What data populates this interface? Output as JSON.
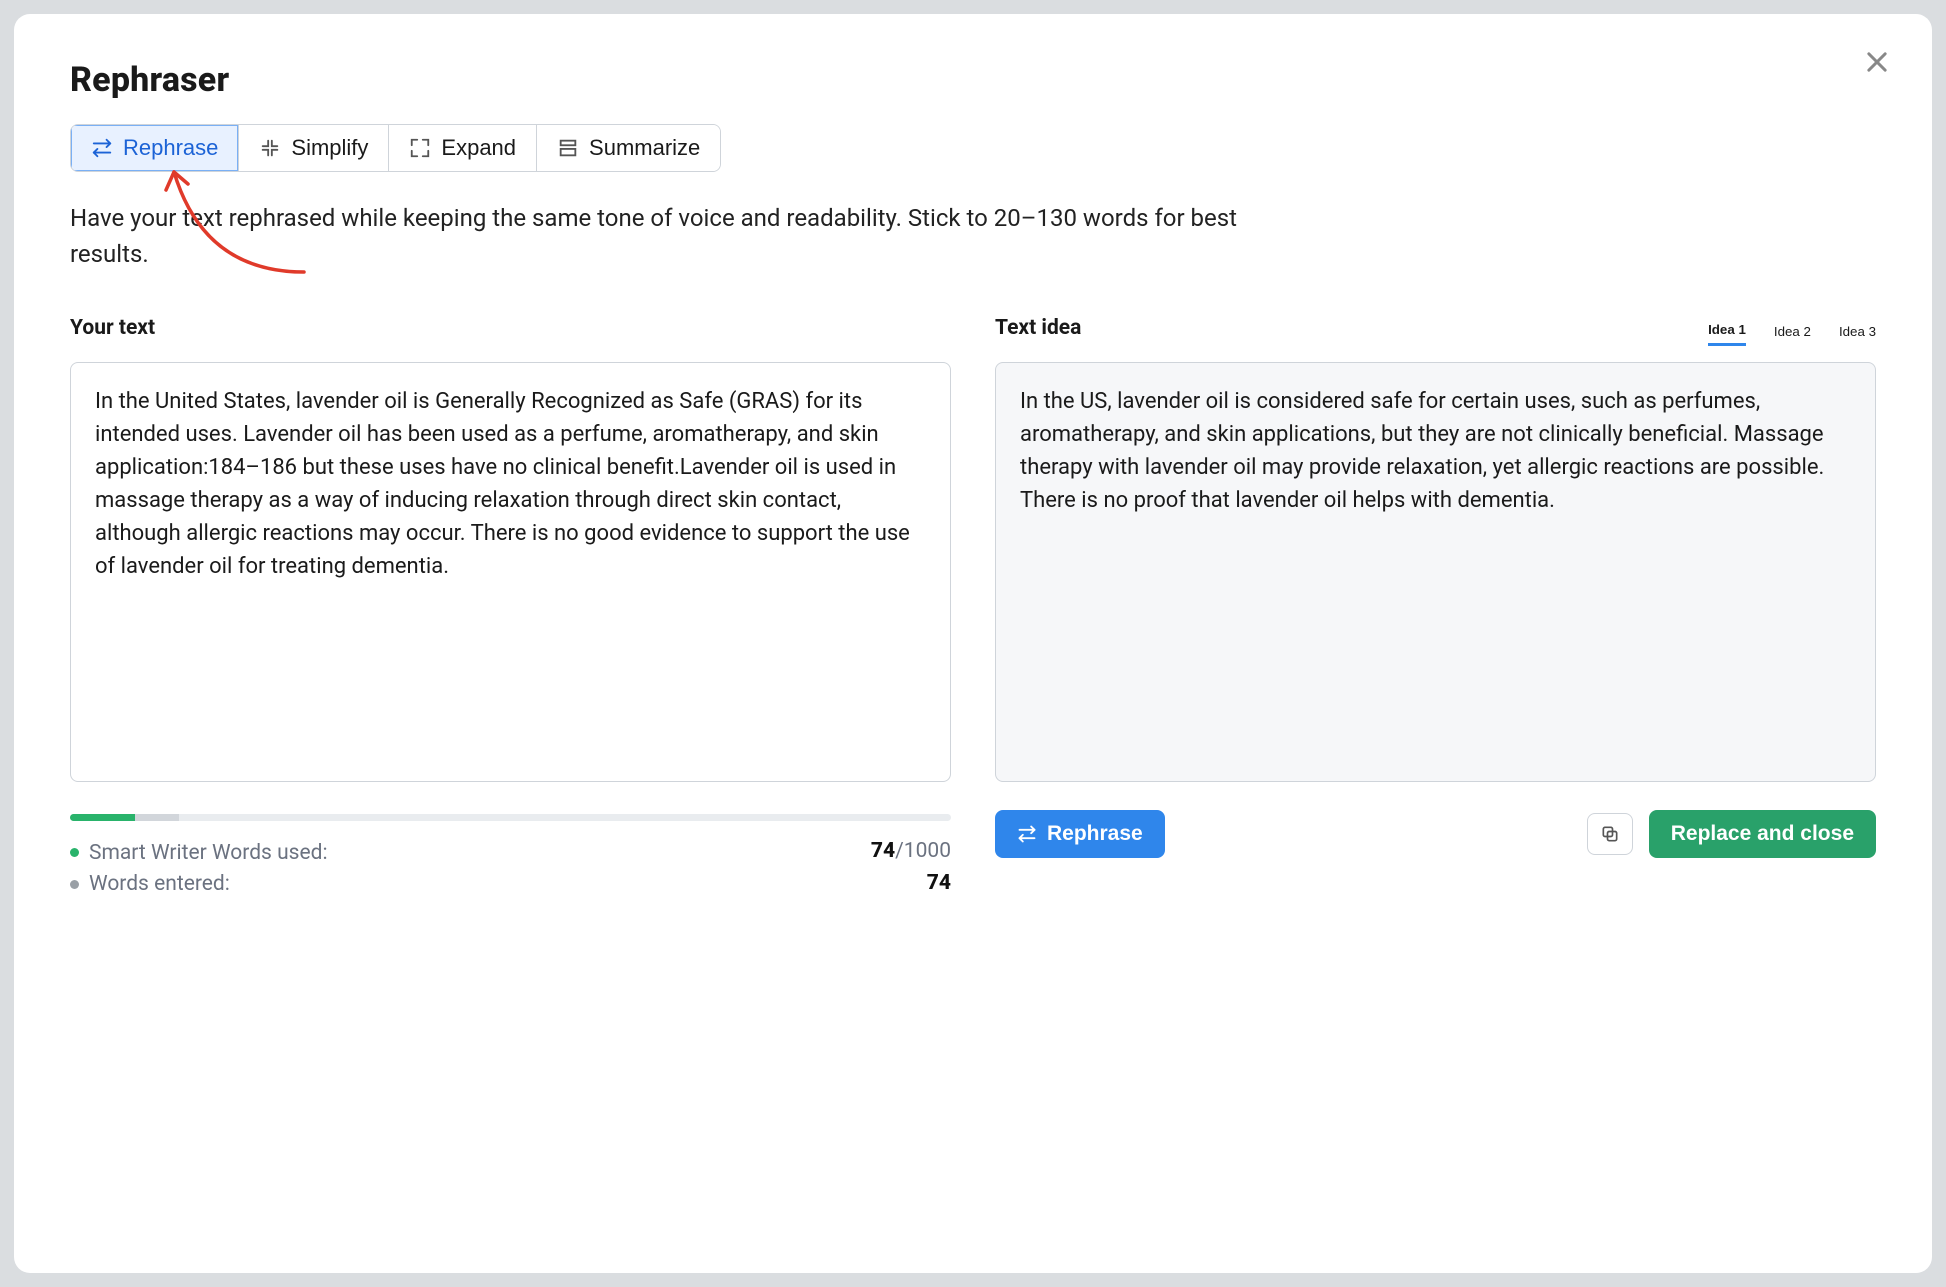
{
  "title": "Rephraser",
  "tabs": {
    "rephrase": "Rephrase",
    "simplify": "Simplify",
    "expand": "Expand",
    "summarize": "Summarize"
  },
  "description": "Have your text rephrased while keeping the same tone of voice and readability. Stick to 20–130 words for best results.",
  "labels": {
    "your_text": "Your text",
    "text_idea": "Text idea"
  },
  "idea_tabs": {
    "idea1": "Idea 1",
    "idea2": "Idea 2",
    "idea3": "Idea 3"
  },
  "input_text": "In the United States, lavender oil is Generally Recognized as Safe (GRAS) for its intended uses. Lavender oil has been used as a perfume, aromatherapy, and skin application:184–186 but these uses have no clinical benefit.Lavender oil is used in massage therapy as a way of inducing relaxation through direct skin contact, although allergic reactions may occur. There is no good evidence to support the use of lavender oil for treating dementia.",
  "output_text": "In the US, lavender oil is considered safe for certain uses, such as perfumes, aromatherapy, and skin applications, but they are not clinically beneficial. Massage therapy with lavender oil may provide relaxation, yet allergic reactions are possible. There is no proof that lavender oil helps with dementia.",
  "stats": {
    "smart_writer_label": "Smart Writer Words used:",
    "smart_writer_used": "74",
    "smart_writer_limit": "/1000",
    "words_entered_label": "Words entered:",
    "words_entered": "74"
  },
  "progress": {
    "fill_percent": 7.4,
    "secondary_start_percent": 7.4,
    "secondary_width_percent": 5
  },
  "actions": {
    "rephrase": "Rephrase",
    "replace_close": "Replace and close"
  }
}
